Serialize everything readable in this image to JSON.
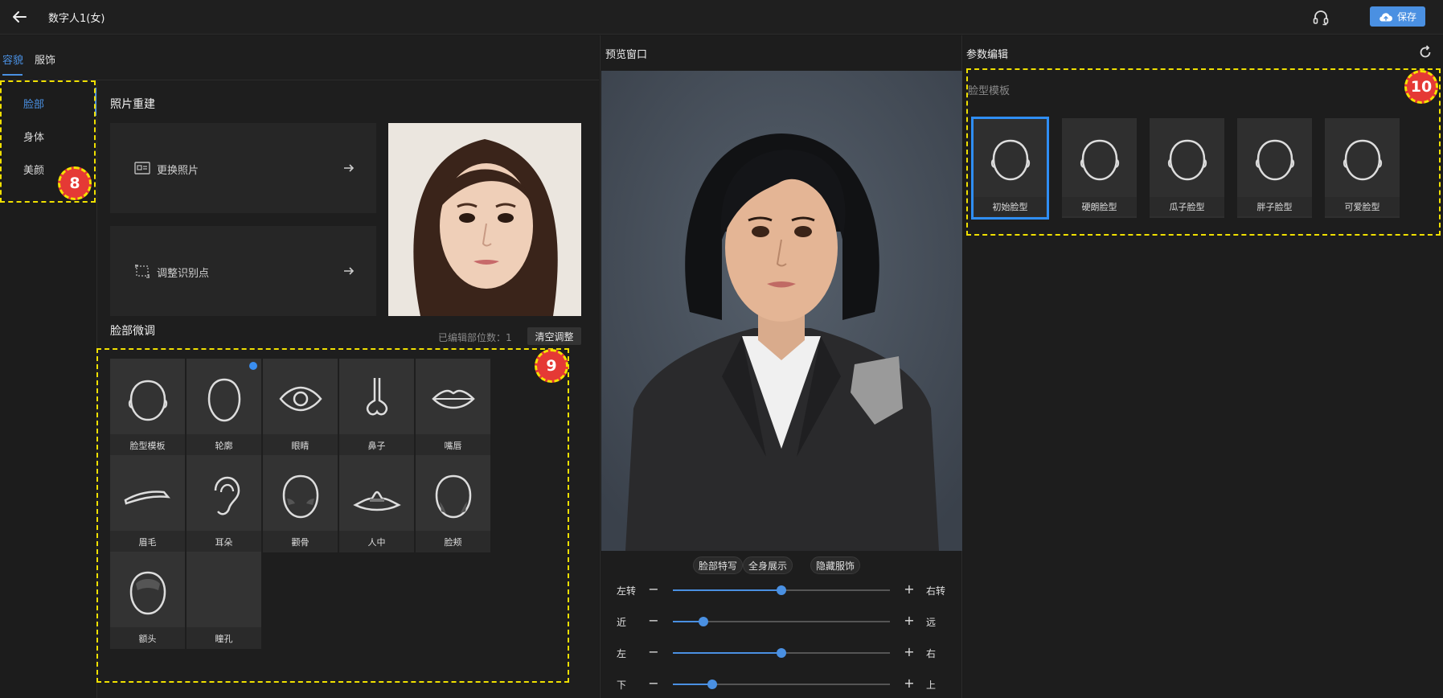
{
  "header": {
    "title": "数字人1(女)",
    "save_label": "保存"
  },
  "main_tabs": [
    {
      "label": "容貌",
      "active": true
    },
    {
      "label": "服饰",
      "active": false
    }
  ],
  "left_nav": [
    {
      "label": "脸部",
      "active": true
    },
    {
      "label": "身体",
      "active": false
    },
    {
      "label": "美颜",
      "active": false
    }
  ],
  "photo_section": {
    "title": "照片重建",
    "change_photo": "更换照片",
    "adjust_points": "调整识别点"
  },
  "fine_tune": {
    "title": "脸部微调",
    "edited_count_label": "已编辑部位数：1",
    "clear_label": "清空调整",
    "items": [
      {
        "label": "脸型模板",
        "icon": "face-template-icon"
      },
      {
        "label": "轮廓",
        "icon": "contour-icon",
        "edited": true
      },
      {
        "label": "眼睛",
        "icon": "eye-icon"
      },
      {
        "label": "鼻子",
        "icon": "nose-icon"
      },
      {
        "label": "嘴唇",
        "icon": "lips-icon"
      },
      {
        "label": "眉毛",
        "icon": "eyebrow-icon"
      },
      {
        "label": "耳朵",
        "icon": "ear-icon"
      },
      {
        "label": "颧骨",
        "icon": "cheekbone-icon"
      },
      {
        "label": "人中",
        "icon": "philtrum-icon"
      },
      {
        "label": "脸颊",
        "icon": "cheek-icon"
      },
      {
        "label": "额头",
        "icon": "forehead-icon"
      },
      {
        "label": "瞳孔",
        "icon": "pupil-icon"
      }
    ]
  },
  "preview": {
    "title": "预览窗口",
    "modes": [
      "脸部特写",
      "全身展示",
      "隐藏服饰"
    ],
    "sliders": [
      {
        "left": "左转",
        "right": "右转",
        "value": 0.5
      },
      {
        "left": "近",
        "right": "远",
        "value": 0.14
      },
      {
        "left": "左",
        "right": "右",
        "value": 0.5
      },
      {
        "left": "下",
        "right": "上",
        "value": 0.18
      }
    ]
  },
  "params": {
    "title": "参数编辑",
    "subtitle": "脸型模板",
    "templates": [
      {
        "label": "初始脸型",
        "selected": true
      },
      {
        "label": "硬朗脸型",
        "selected": false
      },
      {
        "label": "瓜子脸型",
        "selected": false
      },
      {
        "label": "胖子脸型",
        "selected": false
      },
      {
        "label": "可爱脸型",
        "selected": false
      }
    ]
  },
  "annotations": [
    "8",
    "9",
    "10"
  ],
  "colors": {
    "accent": "#4a90e2",
    "annotation_border": "#f0e000",
    "annotation_badge": "#e53935"
  }
}
